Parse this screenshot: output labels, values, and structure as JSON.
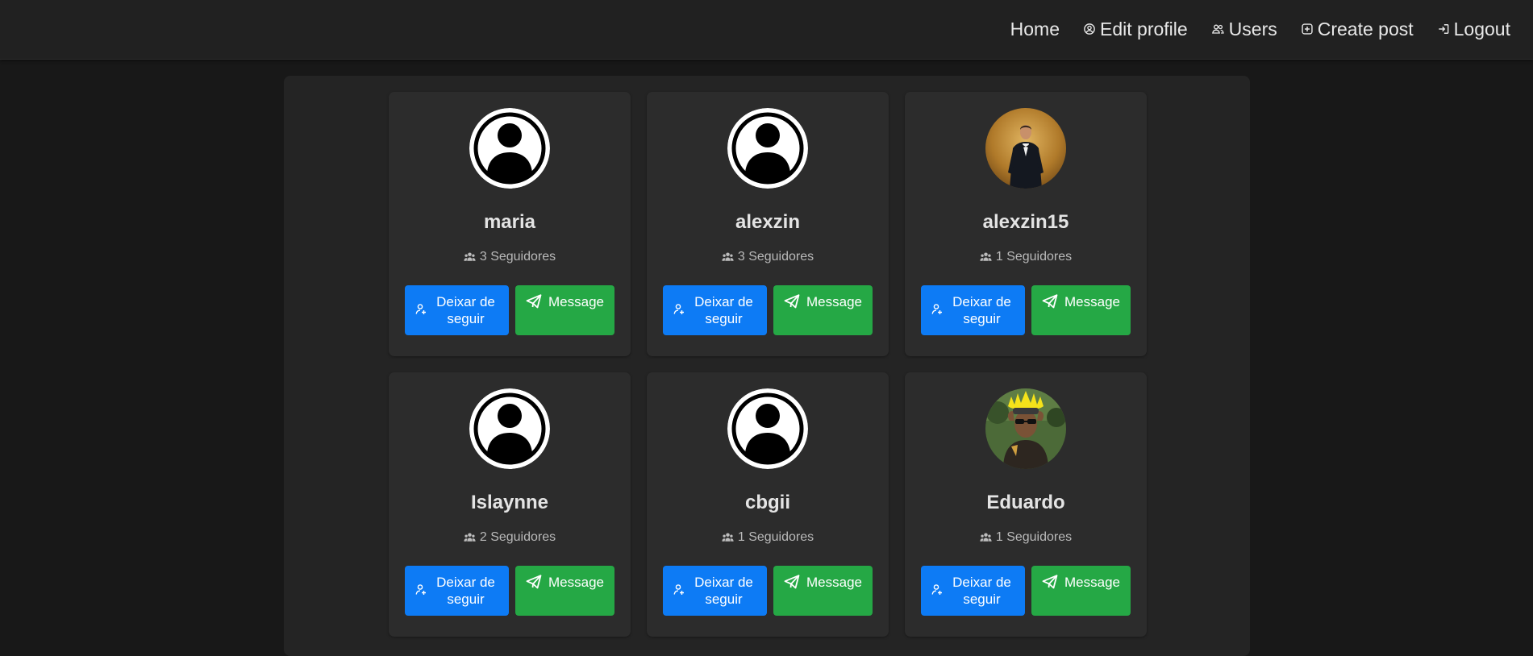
{
  "nav": {
    "home": "Home",
    "edit_profile": "Edit profile",
    "users": "Users",
    "create_post": "Create post",
    "logout": "Logout",
    "icons": [
      "user-circle-icon",
      "users-icon",
      "plus-square-icon",
      "logout-icon"
    ]
  },
  "colors": {
    "follow_button": "#0d7bf5",
    "message_button": "#25a845",
    "page_background": "#181818",
    "card_background": "#2c2c2c"
  },
  "users": [
    {
      "name": "maria",
      "followers": "3 Seguidores",
      "avatar": "default-avatar",
      "follow_label": "Deixar de seguir",
      "message_label": "Message"
    },
    {
      "name": "alexzin",
      "followers": "3 Seguidores",
      "avatar": "default-avatar",
      "follow_label": "Deixar de seguir",
      "message_label": "Message"
    },
    {
      "name": "alexzin15",
      "followers": "1 Seguidores",
      "avatar": "photo-man-in-tuxedo",
      "follow_label": "Deixar de seguir",
      "message_label": "Message"
    },
    {
      "name": "Islaynne",
      "followers": "2 Seguidores",
      "avatar": "default-avatar",
      "follow_label": "Deixar de seguir",
      "message_label": "Message"
    },
    {
      "name": "cbgii",
      "followers": "1 Seguidores",
      "avatar": "default-avatar",
      "follow_label": "Deixar de seguir",
      "message_label": "Message"
    },
    {
      "name": "Eduardo",
      "followers": "1 Seguidores",
      "avatar": "photo-man-with-sunglasses-and-headdress",
      "follow_label": "Deixar de seguir",
      "message_label": "Message"
    }
  ]
}
